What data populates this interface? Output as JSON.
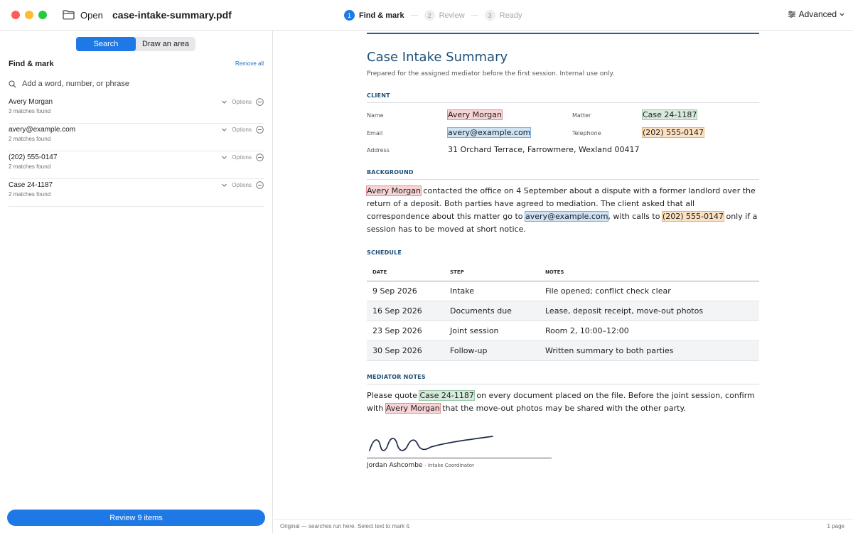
{
  "window": {
    "open_label": "Open",
    "file_name": "case-intake-summary.pdf",
    "advanced_label": "Advanced"
  },
  "steps": [
    {
      "num": "1",
      "label": "Find & mark",
      "active": true
    },
    {
      "num": "2",
      "label": "Review",
      "active": false
    },
    {
      "num": "3",
      "label": "Ready",
      "active": false
    }
  ],
  "sidebar": {
    "mode_search": "Search",
    "mode_draw": "Draw an area",
    "panel_title": "Find & mark",
    "remove_all": "Remove all",
    "add_placeholder": "Add a word, number, or phrase",
    "options_label": "Options",
    "terms": [
      {
        "text": "Avery Morgan",
        "count": "3 matches found"
      },
      {
        "text": "avery@example.com",
        "count": "2 matches found"
      },
      {
        "text": "(202) 555-0147",
        "count": "2 matches found"
      },
      {
        "text": "Case 24-1187",
        "count": "2 matches found"
      }
    ],
    "review_button": "Review 9 items"
  },
  "document": {
    "title": "Case Intake Summary",
    "subtitle": "Prepared for the assigned mediator before the first session. Internal use only.",
    "client": {
      "heading": "CLIENT",
      "name_label": "Name",
      "name_value": "Avery Morgan",
      "matter_label": "Matter",
      "matter_value": "Case 24-1187",
      "email_label": "Email",
      "email_value": "avery@example.com",
      "telephone_label": "Telephone",
      "telephone_value": "(202) 555-0147",
      "address_label": "Address",
      "address_value": "31 Orchard Terrace, Farrowmere, Wexland 00417"
    },
    "background": {
      "heading": "BACKGROUND",
      "hl_name": "Avery Morgan",
      "text_1": " contacted the office on 4 September about a dispute with a former landlord over the return of a deposit. Both parties have agreed to mediation. The client asked that all correspondence about this matter go to ",
      "hl_email": "avery@example.com",
      "text_2": ", with calls to ",
      "hl_phone": "(202) 555-0147",
      "text_3": " only if a session has to be moved at short notice."
    },
    "schedule": {
      "heading": "SCHEDULE",
      "columns": [
        "DATE",
        "STEP",
        "NOTES"
      ],
      "rows": [
        [
          "9 Sep 2026",
          "Intake",
          "File opened; conflict check clear"
        ],
        [
          "16 Sep 2026",
          "Documents due",
          "Lease, deposit receipt, move-out photos"
        ],
        [
          "23 Sep 2026",
          "Joint session",
          "Room 2, 10:00–12:00"
        ],
        [
          "30 Sep 2026",
          "Follow-up",
          "Written summary to both parties"
        ]
      ]
    },
    "mediator_notes": {
      "heading": "MEDIATOR NOTES",
      "text_1": "Please quote ",
      "hl_case": "Case 24-1187",
      "text_2": " on every document placed on the file. Before the joint session, confirm with ",
      "hl_name": "Avery Morgan",
      "text_3": " that the move-out photos may be shared with the other party."
    },
    "signature": {
      "name": "Jordan Ashcombe",
      "role": "· Intake Coordinator"
    }
  },
  "status": {
    "left": "Original — searches run here. Select text to mark it.",
    "right": "1 page"
  },
  "colors": {
    "accent": "#1e79e6",
    "doc_heading": "#1d4f78",
    "highlight_name": "#f7d3d5",
    "highlight_email": "#cfe3f7",
    "highlight_phone": "#fbe0c1",
    "highlight_case": "#d6eadb"
  }
}
